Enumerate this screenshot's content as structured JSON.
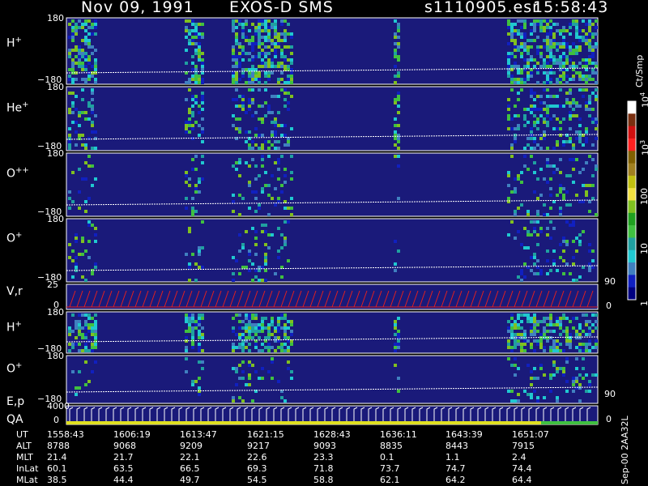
{
  "header": {
    "date": "Nov 09, 1991",
    "instrument": "EXOS-D SMS",
    "file": "s1110905.esr",
    "time": "15:58:43"
  },
  "colorbar": {
    "unit": "Ct/Smp",
    "ticks": [
      {
        "base": "10",
        "exp": "4",
        "frac": 0.0
      },
      {
        "base": "10",
        "exp": "3",
        "frac": 0.24
      },
      {
        "base": "100",
        "exp": "",
        "frac": 0.49
      },
      {
        "base": "10",
        "exp": "",
        "frac": 0.74
      },
      {
        "base": "1",
        "exp": "",
        "frac": 1.0
      }
    ],
    "colors": [
      "#ffffff",
      "#7a2f10",
      "#d01010",
      "#ff2020",
      "#806000",
      "#a08020",
      "#c0c010",
      "#f0e040",
      "#80c020",
      "#20a020",
      "#40c040",
      "#20a0a0",
      "#20c8d0",
      "#4080c0",
      "#1020c0",
      "#000080"
    ]
  },
  "panels": [
    {
      "id": "h-plus-1",
      "ion": "H",
      "charge": "+",
      "ymax": "180",
      "ymin": "−180"
    },
    {
      "id": "he-plus",
      "ion": "He",
      "charge": "+",
      "ymax": "180",
      "ymin": "−180"
    },
    {
      "id": "o-plusplus",
      "ion": "O",
      "charge": "++",
      "ymax": "180",
      "ymin": "−180"
    },
    {
      "id": "o-plus-1",
      "ion": "O",
      "charge": "+",
      "ymax": "180",
      "ymin": "−180"
    },
    {
      "id": "vr",
      "ion": "V,r",
      "charge": "",
      "ymax": "25",
      "ymin": "0"
    },
    {
      "id": "h-plus-2",
      "ion": "H",
      "charge": "+",
      "ymax": "180",
      "ymin": "−180"
    },
    {
      "id": "o-plus-2",
      "ion": "O",
      "charge": "+",
      "ymax": "180",
      "ymin": "−180"
    },
    {
      "id": "ep",
      "ion": "E,p",
      "charge": "",
      "ymax": "4000",
      "ymin": "0"
    }
  ],
  "qa_label": "QA",
  "right_axes": [
    {
      "top": "90",
      "bottom": "0"
    },
    {
      "top": "90",
      "bottom": "0"
    }
  ],
  "table": {
    "rows": [
      {
        "name": "UT",
        "values": [
          "1558:43",
          "1606:19",
          "1613:47",
          "1621:15",
          "1628:43",
          "1636:11",
          "1643:39",
          "1651:07"
        ]
      },
      {
        "name": "ALT",
        "values": [
          "8788",
          "9068",
          "9209",
          "9217",
          "9093",
          "8835",
          "8443",
          "7915"
        ]
      },
      {
        "name": "MLT",
        "values": [
          "21.4",
          "21.7",
          "22.1",
          "22.6",
          "23.3",
          "0.1",
          "1.1",
          "2.4"
        ]
      },
      {
        "name": "InLat",
        "values": [
          "60.1",
          "63.5",
          "66.5",
          "69.3",
          "71.8",
          "73.7",
          "74.7",
          "74.4"
        ]
      },
      {
        "name": "MLat",
        "values": [
          "38.5",
          "44.4",
          "49.7",
          "54.5",
          "58.8",
          "62.1",
          "64.2",
          "64.4"
        ]
      }
    ]
  },
  "footer_code": "Sep-00  2AA32L",
  "chart_data": {
    "type": "heatmap",
    "title": "Nov 09, 1991   EXOS-D SMS",
    "x": [
      "1558:43",
      "1606:19",
      "1613:47",
      "1621:15",
      "1628:43",
      "1636:11",
      "1643:39",
      "1651:07"
    ],
    "series": [
      {
        "name": "H+",
        "ylim": [
          -180,
          180
        ]
      },
      {
        "name": "He+",
        "ylim": [
          -180,
          180
        ]
      },
      {
        "name": "O++",
        "ylim": [
          -180,
          180
        ]
      },
      {
        "name": "O+",
        "ylim": [
          -180,
          180
        ]
      },
      {
        "name": "V,r",
        "ylim": [
          0,
          25
        ]
      },
      {
        "name": "H+",
        "ylim": [
          -180,
          180
        ]
      },
      {
        "name": "O+",
        "ylim": [
          -180,
          180
        ]
      },
      {
        "name": "E,p",
        "ylim": [
          0,
          4000
        ]
      }
    ],
    "colorbar_range": [
      1,
      10000
    ],
    "colorbar_scale": "log"
  }
}
